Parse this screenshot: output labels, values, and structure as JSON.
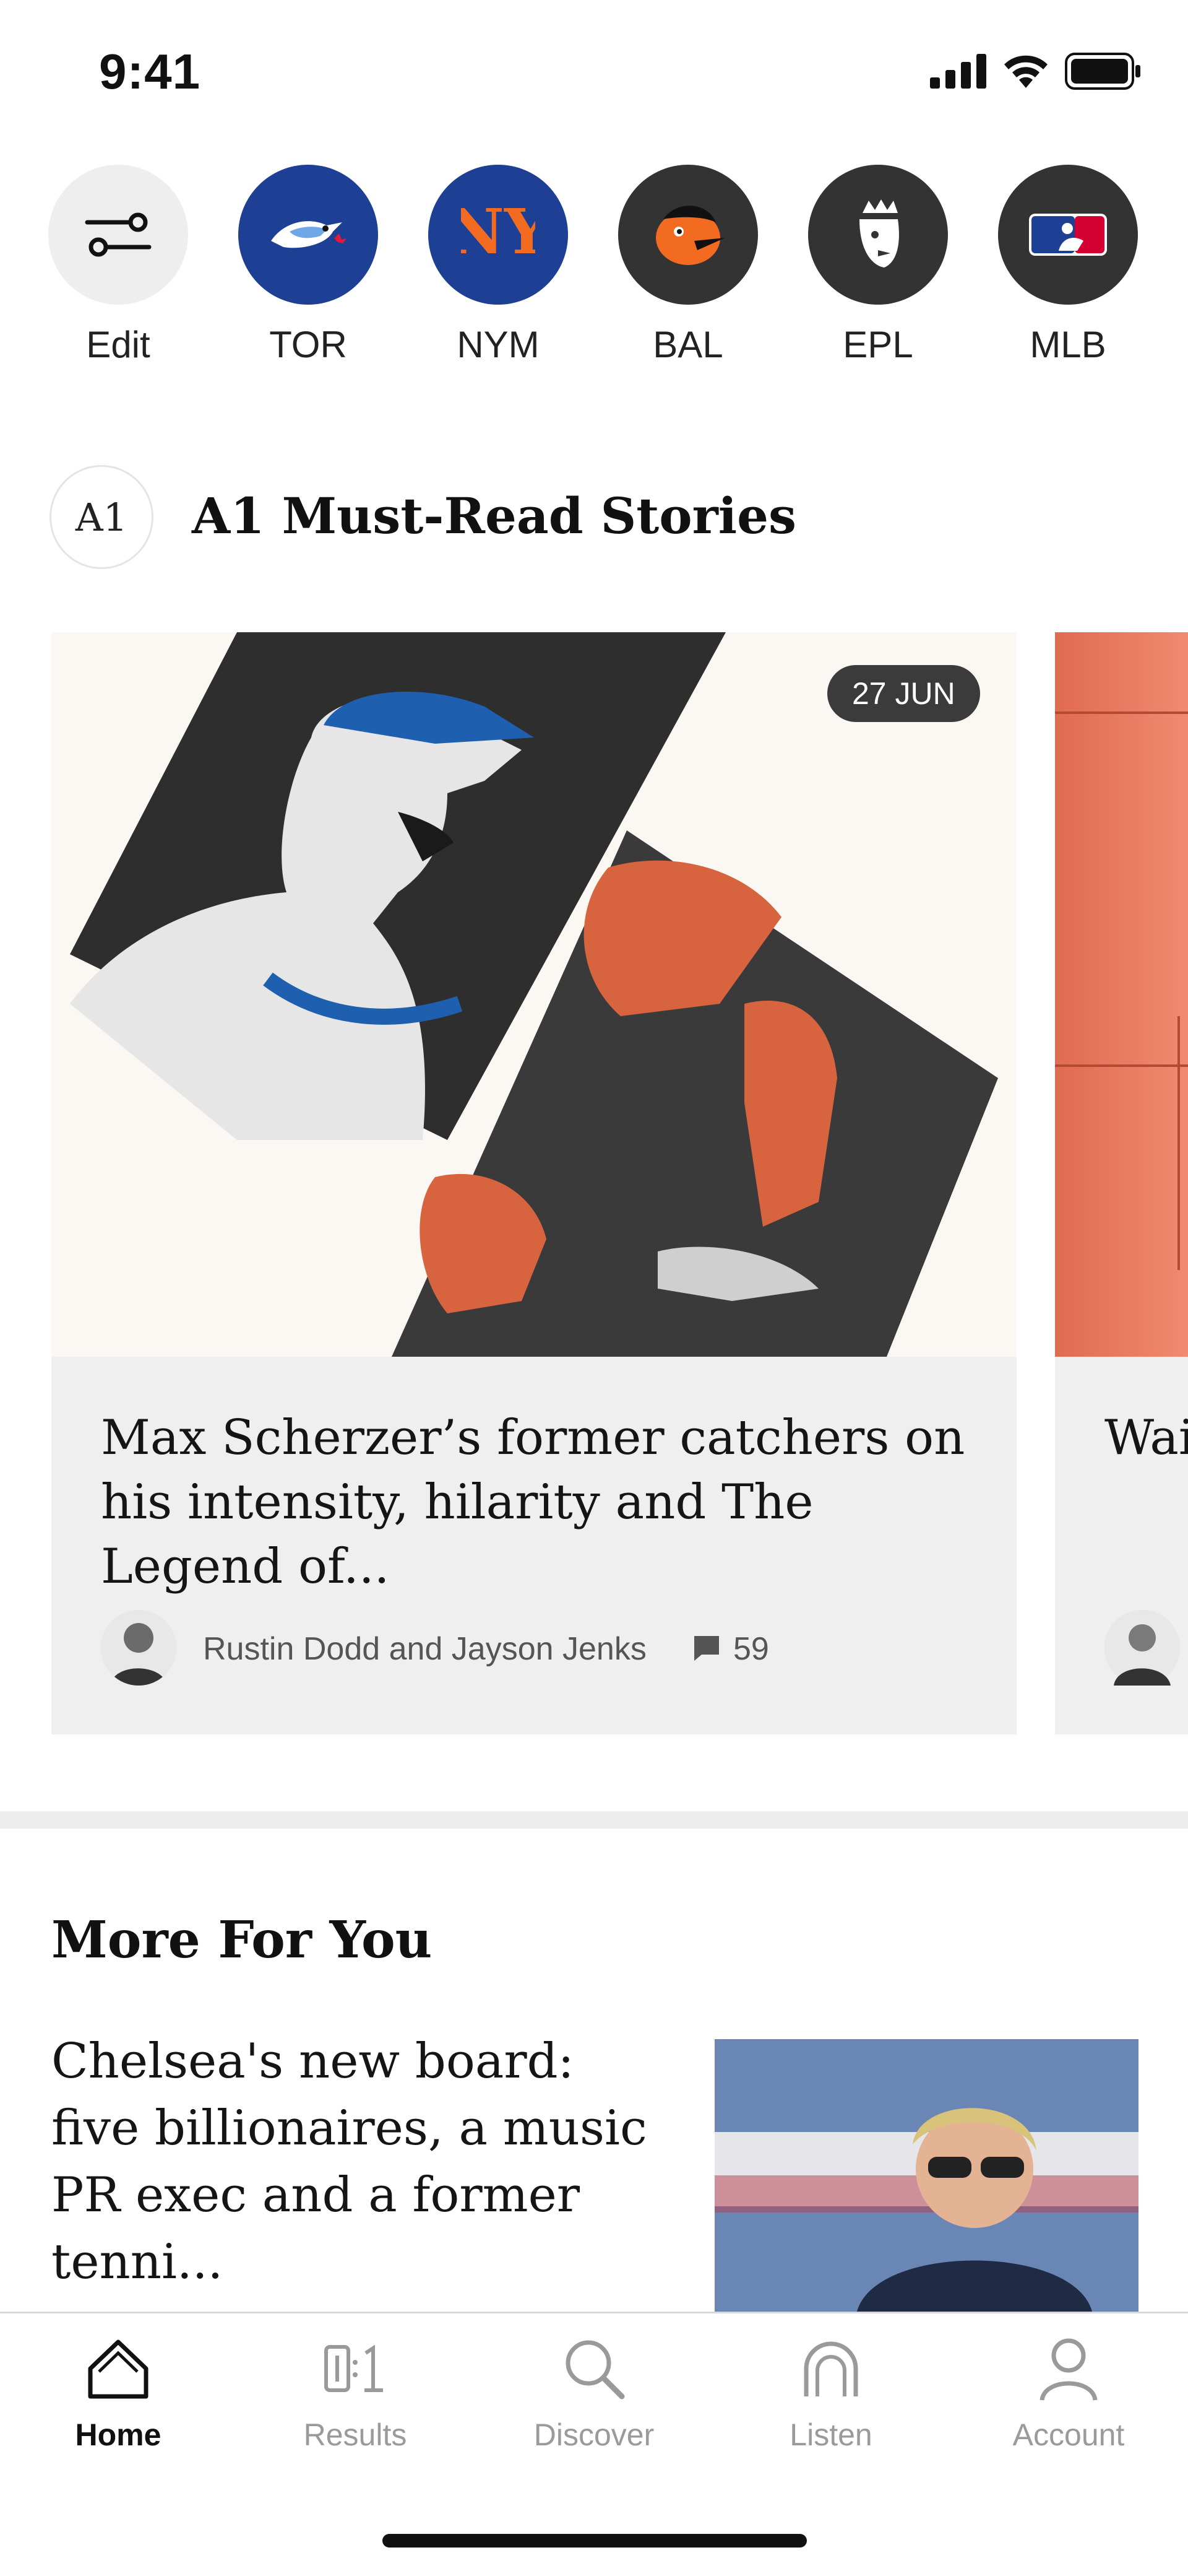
{
  "status_bar": {
    "time": "9:41"
  },
  "teams": [
    {
      "abbr": "Edit",
      "icon": "sliders-icon",
      "bg": "#eeeeee"
    },
    {
      "abbr": "TOR",
      "icon": "blue-jays-logo",
      "bg": "#1d3f94"
    },
    {
      "abbr": "NYM",
      "icon": "mets-logo",
      "bg": "#1d3f94"
    },
    {
      "abbr": "BAL",
      "icon": "orioles-logo",
      "bg": "#333333"
    },
    {
      "abbr": "EPL",
      "icon": "premier-league-logo",
      "bg": "#333333"
    },
    {
      "abbr": "MLB",
      "icon": "mlb-logo",
      "bg": "#333333"
    }
  ],
  "a1_section": {
    "badge": "A1",
    "title": "A1 Must-Read Stories"
  },
  "featured_story": {
    "date": "27 JUN",
    "headline": "Max Scherzer’s former catchers on his intensity, hilarity and The Legend of...",
    "authors": "Rustin Dodd and Jayson Jenks",
    "comments": "59"
  },
  "peek_story": {
    "headline": "Wai dow"
  },
  "more_section": {
    "title": "More For You",
    "headline": "Chelsea's new board: five billionaires, a music PR exec and a former tenni..."
  },
  "tabbar": {
    "home": "Home",
    "results": "Results",
    "discover": "Discover",
    "listen": "Listen",
    "account": "Account"
  },
  "colors": {
    "accent_orange": "#e06b52",
    "team_blue": "#1d3f94",
    "dark_circle": "#333333",
    "card_bg": "#efefef"
  }
}
